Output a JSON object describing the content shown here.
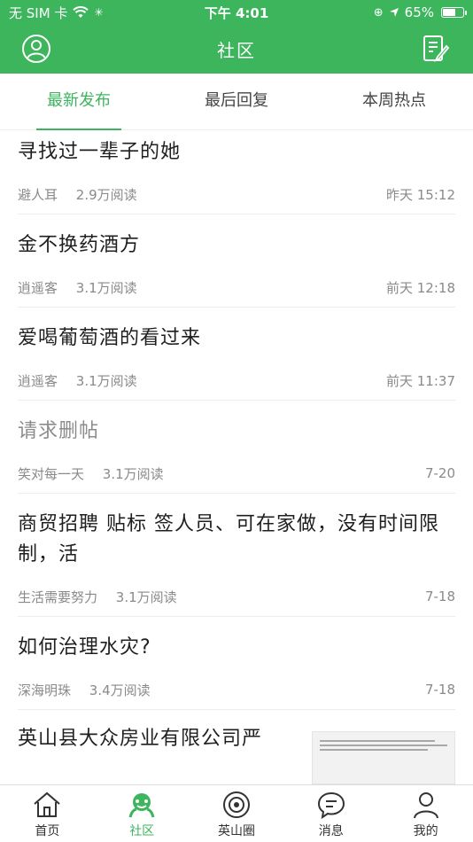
{
  "status_bar": {
    "carrier": "无 SIM 卡",
    "time": "下午 4:01",
    "battery_percent": "65%",
    "battery_level": 0.65
  },
  "header": {
    "title": "社区",
    "left_icon": "user-profile-icon",
    "right_icon": "compose-icon"
  },
  "tabs": [
    {
      "label": "最新发布",
      "active": true
    },
    {
      "label": "最后回复",
      "active": false
    },
    {
      "label": "本周热点",
      "active": false
    }
  ],
  "posts": [
    {
      "title": "寻找过一辈子的她",
      "author": "避人耳",
      "reads": "2.9万阅读",
      "time": "昨天 15:12"
    },
    {
      "title": "金不换药酒方",
      "author": "逍遥客",
      "reads": "3.1万阅读",
      "time": "前天 12:18"
    },
    {
      "title": "爱喝葡萄酒的看过来",
      "author": "逍遥客",
      "reads": "3.1万阅读",
      "time": "前天 11:37"
    },
    {
      "title": "请求删帖",
      "author": "笑对每一天",
      "reads": "3.1万阅读",
      "time": "7-20"
    },
    {
      "title": "商贸招聘 贴标 签人员、可在家做，没有时间限制，活",
      "author": "生活需要努力",
      "reads": "3.1万阅读",
      "time": "7-18"
    },
    {
      "title": "如何治理水灾?",
      "author": "深海明珠",
      "reads": "3.4万阅读",
      "time": "7-18"
    },
    {
      "title": "英山县大众房业有限公司严"
    }
  ],
  "bottom_nav": [
    {
      "label": "首页",
      "icon": "home-icon",
      "active": false
    },
    {
      "label": "社区",
      "icon": "community-icon",
      "active": true
    },
    {
      "label": "英山圈",
      "icon": "circle-icon",
      "active": false
    },
    {
      "label": "消息",
      "icon": "message-icon",
      "active": false
    },
    {
      "label": "我的",
      "icon": "profile-icon",
      "active": false
    }
  ],
  "colors": {
    "brand": "#3cb55c",
    "text": "#1f1f1f",
    "meta": "#8a8a8a"
  }
}
